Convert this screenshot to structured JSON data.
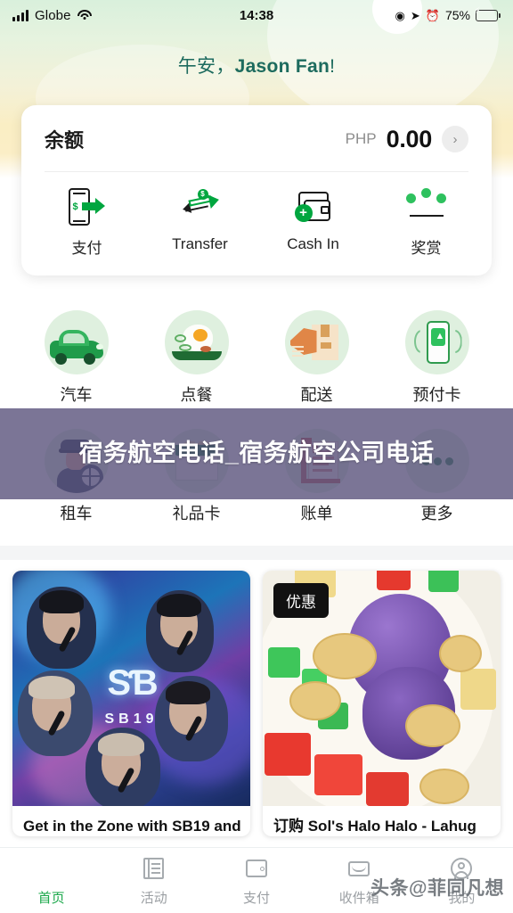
{
  "status_bar": {
    "carrier": "Globe",
    "time": "14:38",
    "battery_percent": "75%",
    "icons": [
      "signal-bars-icon",
      "wifi-icon",
      "location-arrow-icon",
      "alarm-icon",
      "battery-charging-icon"
    ]
  },
  "greeting": {
    "salutation": "午安，",
    "name": "Jason Fan",
    "punctuation": "!"
  },
  "balance": {
    "label": "余额",
    "currency": "PHP",
    "amount": "0.00",
    "chevron": "›"
  },
  "quick_actions": [
    {
      "label": "支付",
      "icon": "phone-payment-icon"
    },
    {
      "label": "Transfer",
      "icon": "transfer-arrows-icon"
    },
    {
      "label": "Cash In",
      "icon": "wallet-plus-icon"
    },
    {
      "label": "奖赏",
      "icon": "crown-icon"
    }
  ],
  "services_row1": [
    {
      "label": "汽车",
      "icon": "car-icon"
    },
    {
      "label": "点餐",
      "icon": "food-plate-icon"
    },
    {
      "label": "配送",
      "icon": "delivery-box-icon"
    },
    {
      "label": "预付卡",
      "icon": "prepaid-load-icon"
    }
  ],
  "services_row2": [
    {
      "label": "租车",
      "icon": "driver-steering-wheel-icon"
    },
    {
      "label": "礼品卡",
      "icon": "gift-envelope-icon"
    },
    {
      "label": "账单",
      "icon": "bill-receipt-icon"
    },
    {
      "label": "更多",
      "icon": "more-dots-icon"
    }
  ],
  "overlay_banner": {
    "text": "宿务航空电话_宿务航空公司电话"
  },
  "promos": [
    {
      "caption": "Get in the Zone with SB19 and",
      "badge": null,
      "artwork": "sb19-concert-photo"
    },
    {
      "caption": "订购 Sol's Halo Halo - Lahug",
      "badge": "优惠",
      "artwork": "halo-halo-dessert-photo"
    }
  ],
  "bottom_nav": [
    {
      "label": "首页",
      "icon": "compass-icon",
      "active": true
    },
    {
      "label": "活动",
      "icon": "pages-icon",
      "active": false
    },
    {
      "label": "支付",
      "icon": "wallet-icon",
      "active": false
    },
    {
      "label": "收件箱",
      "icon": "inbox-icon",
      "active": false
    },
    {
      "label": "我的",
      "icon": "profile-icon",
      "active": false
    }
  ],
  "watermark": {
    "text": "头条@菲同凡想"
  },
  "colors": {
    "brand_green": "#16a94c",
    "accent_green": "#00a63f",
    "greeting_teal": "#1d6b5e",
    "overlay_purple": "#564e78",
    "nav_inactive": "#9b9fa3"
  }
}
